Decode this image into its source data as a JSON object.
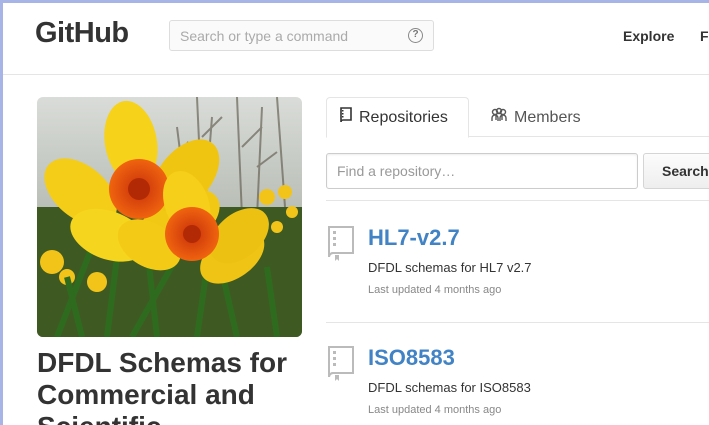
{
  "header": {
    "logo": "GitHub",
    "search_placeholder": "Search or type a command",
    "search_hint_glyph": "?",
    "nav": [
      "Explore",
      "F"
    ]
  },
  "org": {
    "name": "DFDL Schemas for Commercial and Scientific"
  },
  "tabs": [
    {
      "label": "Repositories",
      "icon": "repo-icon",
      "active": true
    },
    {
      "label": "Members",
      "icon": "members-icon",
      "active": false
    }
  ],
  "filter": {
    "placeholder": "Find a repository…",
    "button_label": "Search"
  },
  "repos": [
    {
      "name": "HL7-v2.7",
      "description": "DFDL schemas for HL7 v2.7",
      "updated": "Last updated 4 months ago"
    },
    {
      "name": "ISO8583",
      "description": "DFDL schemas for ISO8583",
      "updated": "Last updated 4 months ago"
    }
  ],
  "colors": {
    "link": "#4183c4",
    "frame": "#a7b4e6"
  }
}
